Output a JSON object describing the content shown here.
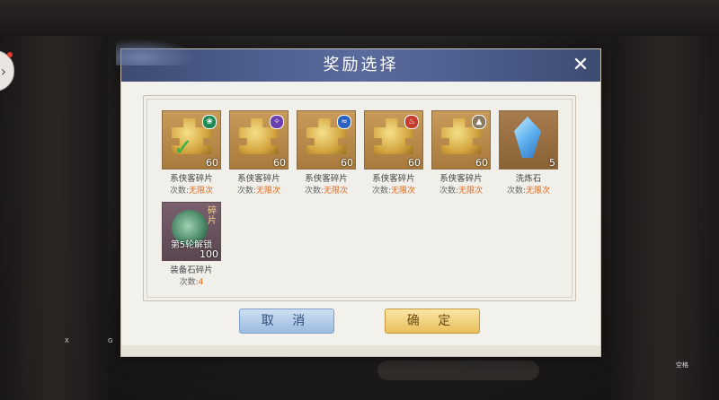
{
  "dialog": {
    "title": "奖励选择",
    "cancel_label": "取 消",
    "confirm_label": "确 定"
  },
  "items": [
    {
      "name": "系侠客碎片",
      "qty": "60",
      "times_label": "次数:",
      "times_value": "无限次",
      "selected": true,
      "badge_icon": "green-element-icon"
    },
    {
      "name": "系侠客碎片",
      "qty": "60",
      "times_label": "次数:",
      "times_value": "无限次",
      "badge_icon": "purple-element-icon"
    },
    {
      "name": "系侠客碎片",
      "qty": "60",
      "times_label": "次数:",
      "times_value": "无限次",
      "badge_icon": "blue-element-icon"
    },
    {
      "name": "系侠客碎片",
      "qty": "60",
      "times_label": "次数:",
      "times_value": "无限次",
      "badge_icon": "red-element-icon"
    },
    {
      "name": "系侠客碎片",
      "qty": "60",
      "times_label": "次数:",
      "times_value": "无限次",
      "badge_icon": "gray-element-icon"
    },
    {
      "name": "洗炼石",
      "qty": "5",
      "times_label": "次数:",
      "times_value": "无限次",
      "icon": "blue-crystal-icon"
    },
    {
      "name": "装备石碎片",
      "qty": "100",
      "times_label": "次数:",
      "times_value": "4",
      "tag": "碎片",
      "overlay": "第5轮解锁",
      "icon": "jade-relic-icon"
    }
  ],
  "background": {
    "corner_x": "X",
    "corner_g": "G",
    "corner_br": "空格"
  }
}
